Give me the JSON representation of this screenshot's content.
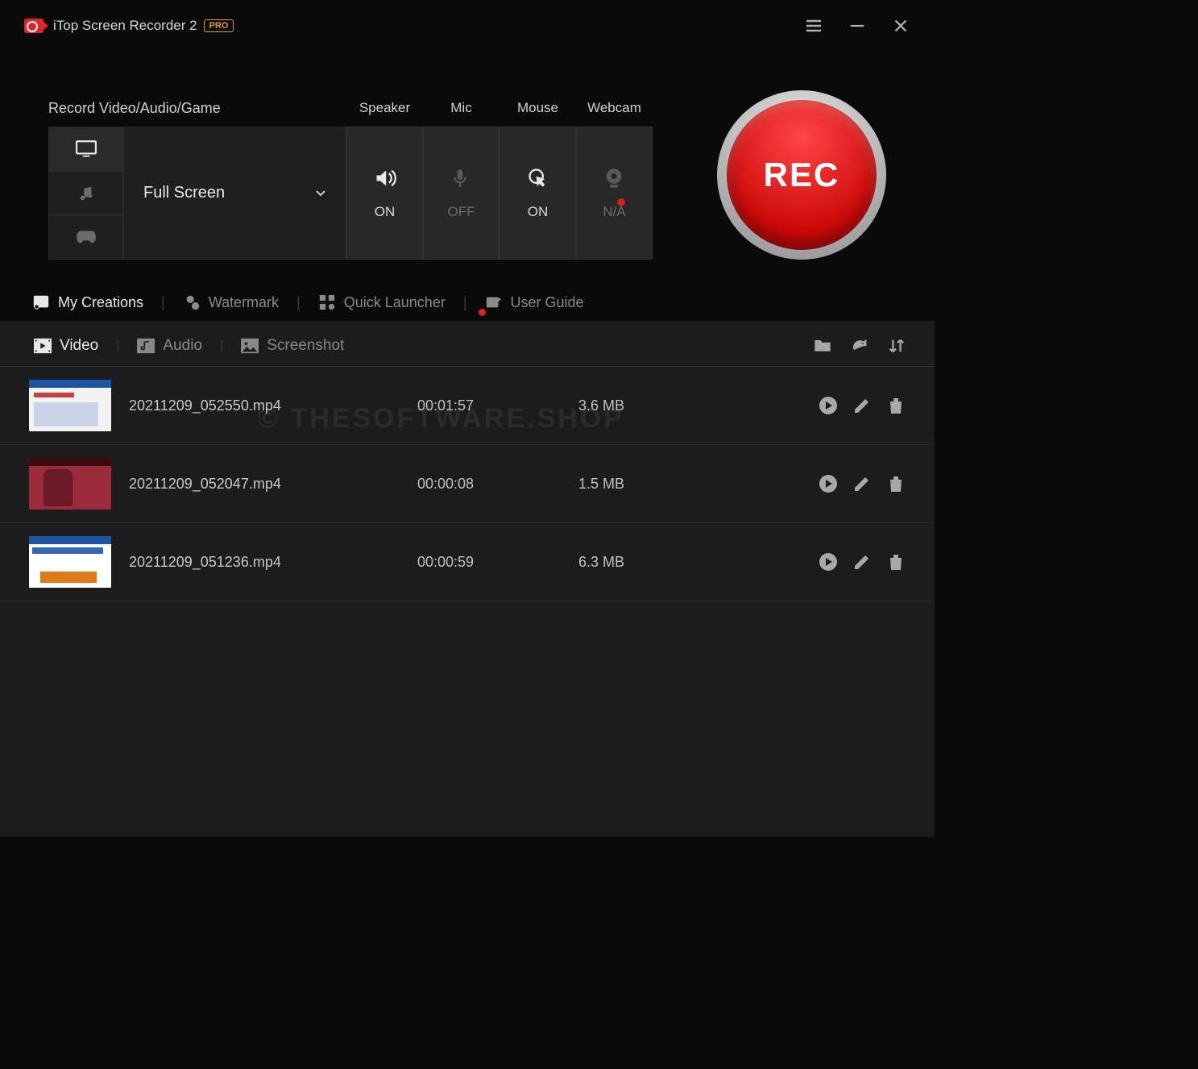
{
  "title": "iTop Screen Recorder 2",
  "pro_label": "PRO",
  "config": {
    "heading": "Record Video/Audio/Game",
    "region_label": "Full Screen",
    "columns": {
      "speaker": {
        "label": "Speaker",
        "status": "ON"
      },
      "mic": {
        "label": "Mic",
        "status": "OFF"
      },
      "mouse": {
        "label": "Mouse",
        "status": "ON"
      },
      "webcam": {
        "label": "Webcam",
        "status": "N/A"
      }
    }
  },
  "rec_label": "REC",
  "mid_nav": {
    "creations": "My Creations",
    "watermark": "Watermark",
    "launcher": "Quick Launcher",
    "guide": "User Guide"
  },
  "list_tabs": {
    "video": "Video",
    "audio": "Audio",
    "screenshot": "Screenshot"
  },
  "files": [
    {
      "name": "20211209_052550.mp4",
      "duration": "00:01:57",
      "size": "3.6 MB"
    },
    {
      "name": "20211209_052047.mp4",
      "duration": "00:00:08",
      "size": "1.5 MB"
    },
    {
      "name": "20211209_051236.mp4",
      "duration": "00:00:59",
      "size": "6.3 MB"
    }
  ],
  "watermark_text": "© THESOFTWARE.SHOP"
}
